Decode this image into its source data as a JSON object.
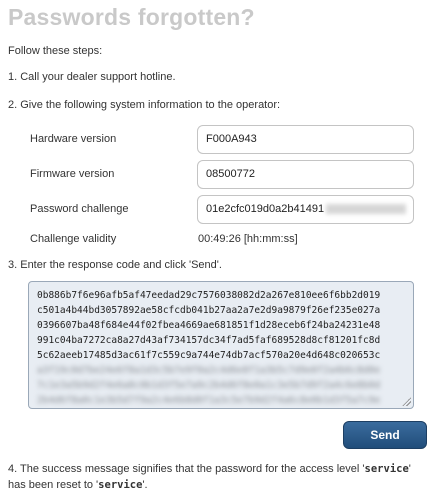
{
  "page": {
    "title": "Passwords forgotten?"
  },
  "intro": "Follow these steps:",
  "step1": "1. Call your dealer support hotline.",
  "step2": "2. Give the following system information to the operator:",
  "hardware": {
    "label": "Hardware version",
    "value": "F000A943"
  },
  "firmware": {
    "label": "Firmware version",
    "value": "08500772"
  },
  "challenge": {
    "label": "Password challenge",
    "value": "01e2cfc019d0a2b41491"
  },
  "validity": {
    "label": "Challenge validity",
    "value": "00:49:26 [hh:mm:ss]"
  },
  "step3": "3. Enter the response code and click 'Send'.",
  "response_lines": [
    "0b886b7f6e96afb5af47eedad29c7576038082d2a267e810ee6f6bb2d019",
    "c501a4b44bd3057892ae58cfcdb041b27aa2a7e2d9a9879f26ef235e027a",
    "0396607ba48f684e44f02fbea4669ae681851f1d28eceb6f24ba24231e48",
    "991c04ba7272ca8a27d43af734157dc34f7ad5faf689528d8cf81201fc8d",
    "5c62aeeb17485d3ac61f7c559c9a744e74db7acf570a20e4d648c020653c"
  ],
  "send_label": "Send",
  "step4": {
    "before": "4. The success message signifies that the password for the access level '",
    "level": "service",
    "middle": "' has been reset to '",
    "password": "service",
    "after": "'."
  }
}
